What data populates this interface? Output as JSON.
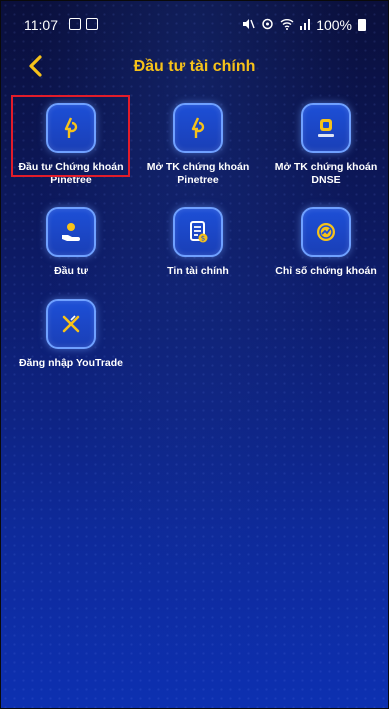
{
  "status_bar": {
    "time": "11:07",
    "battery": "100%"
  },
  "header": {
    "title": "Đầu tư tài chính"
  },
  "tiles": [
    {
      "label": "Đầu tư Chứng khoán\nPinetree",
      "icon": "pinetree-logo-icon"
    },
    {
      "label": "Mở TK chứng khoán\nPinetree",
      "icon": "pinetree-logo-icon"
    },
    {
      "label": "Mở TK chứng khoán\nDNSE",
      "icon": "dnse-logo-icon"
    },
    {
      "label": "Đầu tư",
      "icon": "hand-coin-icon"
    },
    {
      "label": "Tin tài chính",
      "icon": "financial-news-icon"
    },
    {
      "label": "Chỉ số chứng khoán",
      "icon": "stock-index-icon"
    },
    {
      "label": "Đăng nhập YouTrade",
      "icon": "youtrade-logo-icon"
    }
  ],
  "colors": {
    "accent": "#f6c21a",
    "highlight": "#e21c2a",
    "tile_border": "#6fa0ff"
  }
}
